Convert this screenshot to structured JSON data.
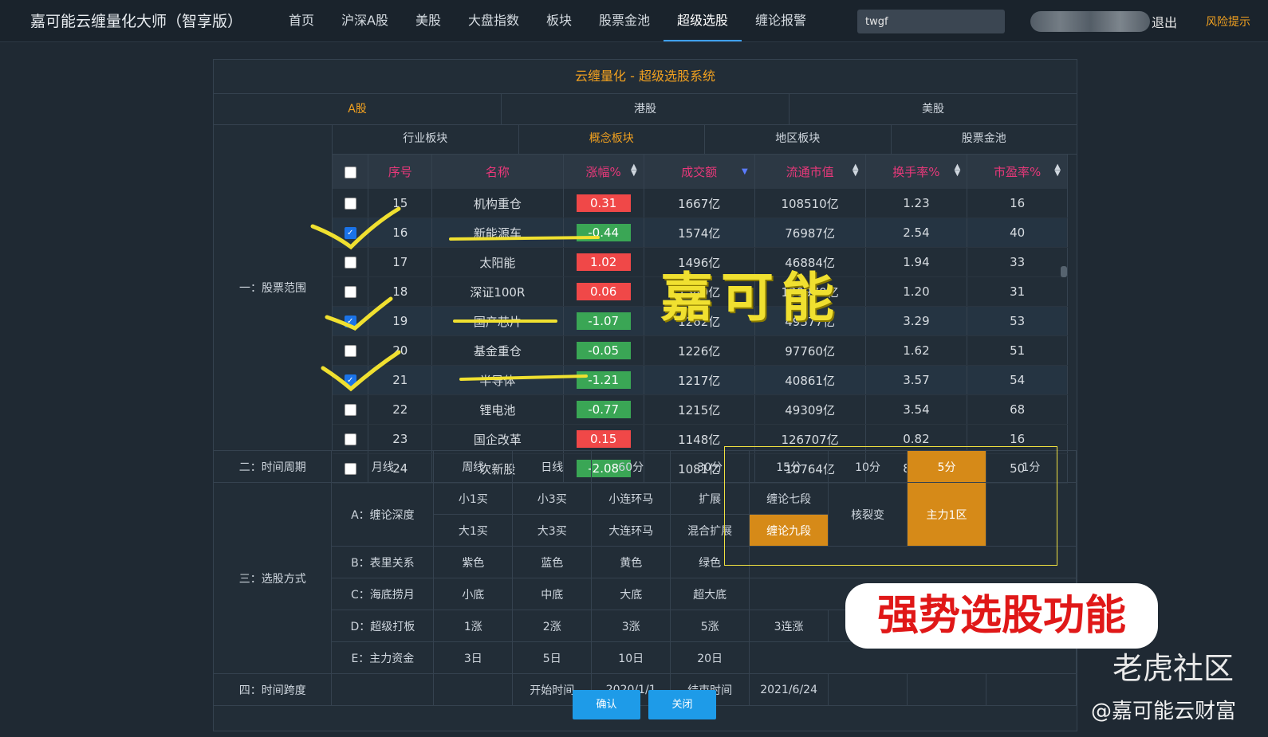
{
  "nav": {
    "brand": "嘉可能云缠量化大师（智享版）",
    "items": [
      "首页",
      "沪深A股",
      "美股",
      "大盘指数",
      "板块",
      "股票金池",
      "超级选股",
      "缠论报警"
    ],
    "active_index": 6,
    "search_value": "twgf",
    "logout": "退出",
    "risk": "风险提示"
  },
  "panel": {
    "title": "云缠量化 - 超级选股系统",
    "markets": [
      "A股",
      "港股",
      "美股"
    ],
    "active_market": "A股",
    "section1_label": "一：股票范围",
    "subtabs": [
      "行业板块",
      "概念板块",
      "地区板块",
      "股票金池"
    ],
    "active_subtab": "概念板块",
    "columns": [
      "序号",
      "名称",
      "涨幅%",
      "成交额",
      "流通市值",
      "换手率%",
      "市盈率%"
    ],
    "rows": [
      {
        "no": "15",
        "name": "机构重仓",
        "chg": "0.31",
        "vol": "1667亿",
        "cap": "108510亿",
        "turn": "1.23",
        "pe": "16",
        "checked": false
      },
      {
        "no": "16",
        "name": "新能源车",
        "chg": "-0.44",
        "vol": "1574亿",
        "cap": "76987亿",
        "turn": "2.54",
        "pe": "40",
        "checked": true
      },
      {
        "no": "17",
        "name": "太阳能",
        "chg": "1.02",
        "vol": "1496亿",
        "cap": "46884亿",
        "turn": "1.94",
        "pe": "33",
        "checked": false
      },
      {
        "no": "18",
        "name": "深证100R",
        "chg": "0.06",
        "vol": "1349亿",
        "cap": "130970亿",
        "turn": "1.20",
        "pe": "31",
        "checked": false
      },
      {
        "no": "19",
        "name": "国产芯片",
        "chg": "-1.07",
        "vol": "1262亿",
        "cap": "49577亿",
        "turn": "3.29",
        "pe": "53",
        "checked": true
      },
      {
        "no": "20",
        "name": "基金重仓",
        "chg": "-0.05",
        "vol": "1226亿",
        "cap": "97760亿",
        "turn": "1.62",
        "pe": "51",
        "checked": false
      },
      {
        "no": "21",
        "name": "半导体",
        "chg": "-1.21",
        "vol": "1217亿",
        "cap": "40861亿",
        "turn": "3.57",
        "pe": "54",
        "checked": true
      },
      {
        "no": "22",
        "name": "锂电池",
        "chg": "-0.77",
        "vol": "1215亿",
        "cap": "49309亿",
        "turn": "3.54",
        "pe": "68",
        "checked": false
      },
      {
        "no": "23",
        "name": "国企改革",
        "chg": "0.15",
        "vol": "1148亿",
        "cap": "126707亿",
        "turn": "0.82",
        "pe": "16",
        "checked": false
      },
      {
        "no": "24",
        "name": "次新股",
        "chg": "-2.08",
        "vol": "1081亿",
        "cap": "10764亿",
        "turn": "8.29",
        "pe": "50",
        "checked": false
      }
    ]
  },
  "options": {
    "period_label": "二：时间周期",
    "periods": [
      "月线",
      "周线",
      "日线",
      "60分",
      "30分",
      "15分",
      "10分",
      "5分",
      "1分"
    ],
    "active_period": "5分",
    "method_label": "三：选股方式",
    "A_label": "A：缠论深度",
    "A_row1": [
      "小1买",
      "小3买",
      "小连环马",
      "扩展",
      "缠论七段"
    ],
    "A_row2": [
      "大1买",
      "大3买",
      "大连环马",
      "混合扩展",
      "缠论九段"
    ],
    "A_extra": [
      "核裂变",
      "主力1区"
    ],
    "B_label": "B：表里关系",
    "B": [
      "紫色",
      "蓝色",
      "黄色",
      "绿色"
    ],
    "C_label": "C：海底捞月",
    "C": [
      "小底",
      "中底",
      "大底",
      "超大底"
    ],
    "D_label": "D：超级打板",
    "D": [
      "1涨",
      "2涨",
      "3涨",
      "5涨",
      "3连涨"
    ],
    "E_label": "E：主力资金",
    "E": [
      "3日",
      "5日",
      "10日",
      "20日"
    ],
    "span_label": "四：时间跨度",
    "start_label": "开始时间",
    "start": "2020/1/1",
    "end_label": "结束时间",
    "end": "2021/6/24",
    "confirm": "确认",
    "close": "关闭"
  },
  "overlays": {
    "logo_text": "嘉可能",
    "stamp_text": "强势选股功能",
    "watermark": "老虎社区",
    "credit": "@嘉可能云财富"
  },
  "colors": {
    "accent": "#f0a020",
    "highlight": "#d68a18",
    "name_text": "#e028d0",
    "up": "#f04848",
    "down": "#3aa655"
  }
}
